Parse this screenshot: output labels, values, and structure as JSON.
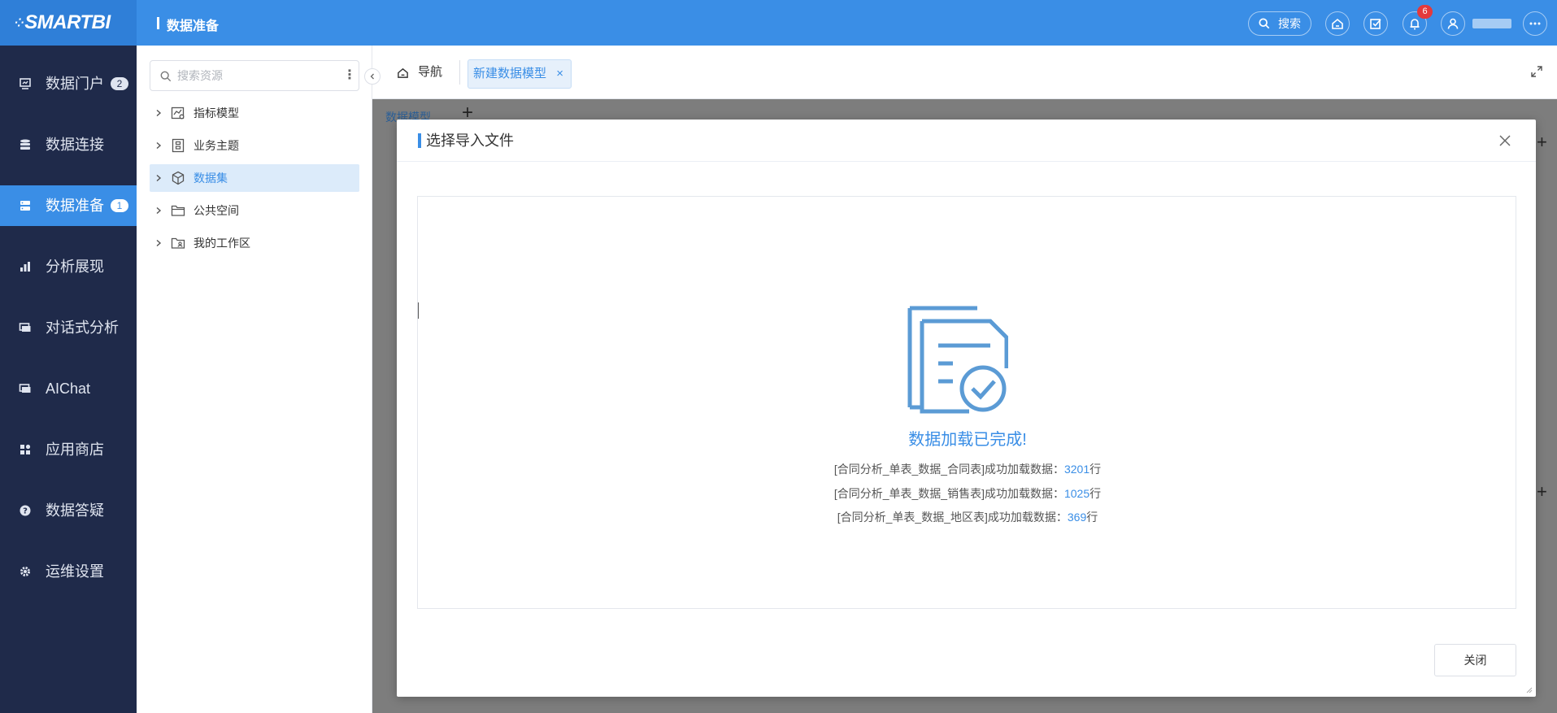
{
  "header": {
    "brand": "SMARTBI",
    "module_title": "数据准备",
    "search_label": "搜索",
    "notification_count": "6"
  },
  "sidebar": {
    "items": [
      {
        "label": "数据门户",
        "badge": "2",
        "icon": "portal-icon"
      },
      {
        "label": "数据连接",
        "icon": "database-icon"
      },
      {
        "label": "数据准备",
        "badge": "1",
        "icon": "server-icon",
        "active": true
      },
      {
        "label": "分析展现",
        "icon": "bar-chart-icon"
      },
      {
        "label": "对话式分析",
        "icon": "chat-icon"
      },
      {
        "label": "AIChat",
        "icon": "ai-chat-icon"
      },
      {
        "label": "应用商店",
        "icon": "app-store-icon"
      },
      {
        "label": "数据答疑",
        "icon": "question-icon"
      },
      {
        "label": "运维设置",
        "icon": "gear-icon"
      }
    ]
  },
  "tree": {
    "search_placeholder": "搜索资源",
    "items": [
      {
        "label": "指标模型",
        "icon": "metric-model-icon"
      },
      {
        "label": "业务主题",
        "icon": "business-theme-icon"
      },
      {
        "label": "数据集",
        "icon": "cube-icon",
        "selected": true
      },
      {
        "label": "公共空间",
        "icon": "folder-icon"
      },
      {
        "label": "我的工作区",
        "icon": "user-folder-icon"
      }
    ]
  },
  "tabs": {
    "nav_label": "导航",
    "active_tab": "新建数据模型"
  },
  "workspace": {
    "inner_tab": "数据模型"
  },
  "modal": {
    "title": "选择导入文件",
    "status_title": "数据加载已完成!",
    "results": [
      {
        "text": "[合同分析_单表_数据_合同表]成功加载数据：",
        "count": "3201",
        "unit": "行"
      },
      {
        "text": "[合同分析_单表_数据_销售表]成功加载数据：",
        "count": "1025",
        "unit": "行"
      },
      {
        "text": "[合同分析_单表_数据_地区表]成功加载数据：",
        "count": "369",
        "unit": "行"
      }
    ],
    "close_button": "关闭"
  },
  "colors": {
    "primary": "#3a8ee6",
    "sidebar_bg": "#1f2a4a",
    "overlay": "#7d7d7d",
    "badge_red": "#e4393c"
  }
}
